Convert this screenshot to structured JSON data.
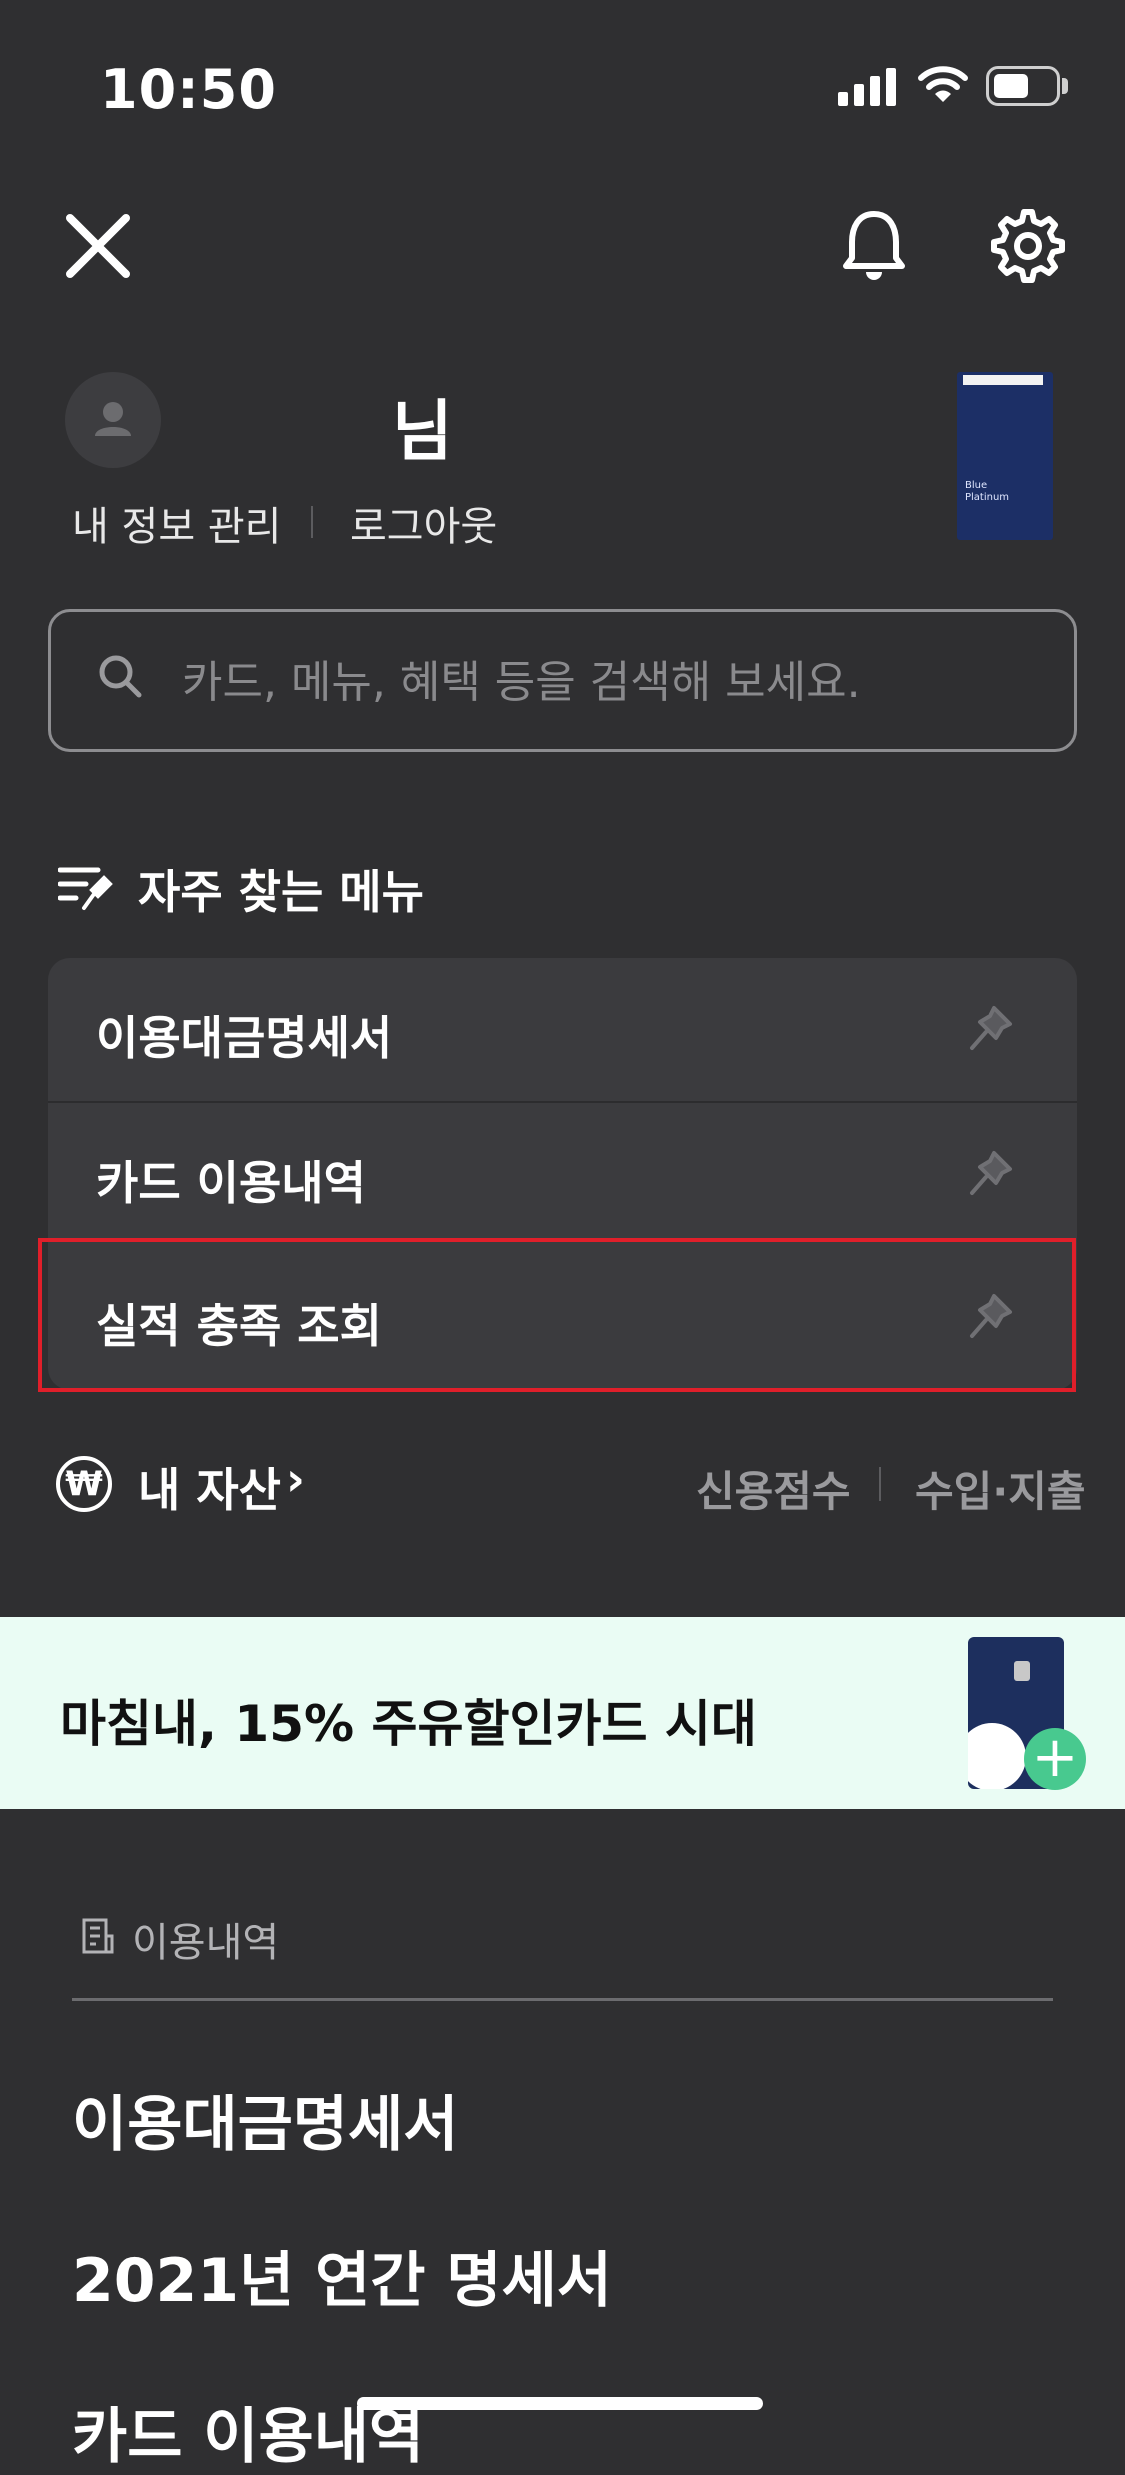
{
  "status_bar": {
    "time": "10:50"
  },
  "header": {
    "user_name": "님",
    "profile_link": "내 정보 관리",
    "logout_link": "로그아웃"
  },
  "search": {
    "placeholder": "카드, 메뉴, 혜택 등을 검색해 보세요."
  },
  "favorites": {
    "title": "자주 찾는 메뉴",
    "items": [
      {
        "label": "이용대금명세서"
      },
      {
        "label": "카드 이용내역"
      },
      {
        "label": "실적 충족 조회"
      }
    ]
  },
  "assets": {
    "title": "내 자산",
    "chevron": "›",
    "won_symbol": "₩",
    "links": [
      "신용점수",
      "수입·지출"
    ]
  },
  "banner": {
    "text": "마침내, 15% 주유할인카드 시대"
  },
  "usage": {
    "title": "이용내역",
    "items": [
      "이용대금명세서",
      "2021년 연간 명세서",
      "카드 이용내역"
    ]
  },
  "colors": {
    "background": "#2f2f31",
    "card_list": "#3b3b3e",
    "highlight": "#e01f2a",
    "banner_bg": "#eafcf4",
    "banner_accent": "#48c98f"
  },
  "icons": [
    "close-icon",
    "bell-icon",
    "gear-icon",
    "user-icon",
    "search-icon",
    "pin-icon",
    "won-icon",
    "receipt-icon"
  ]
}
